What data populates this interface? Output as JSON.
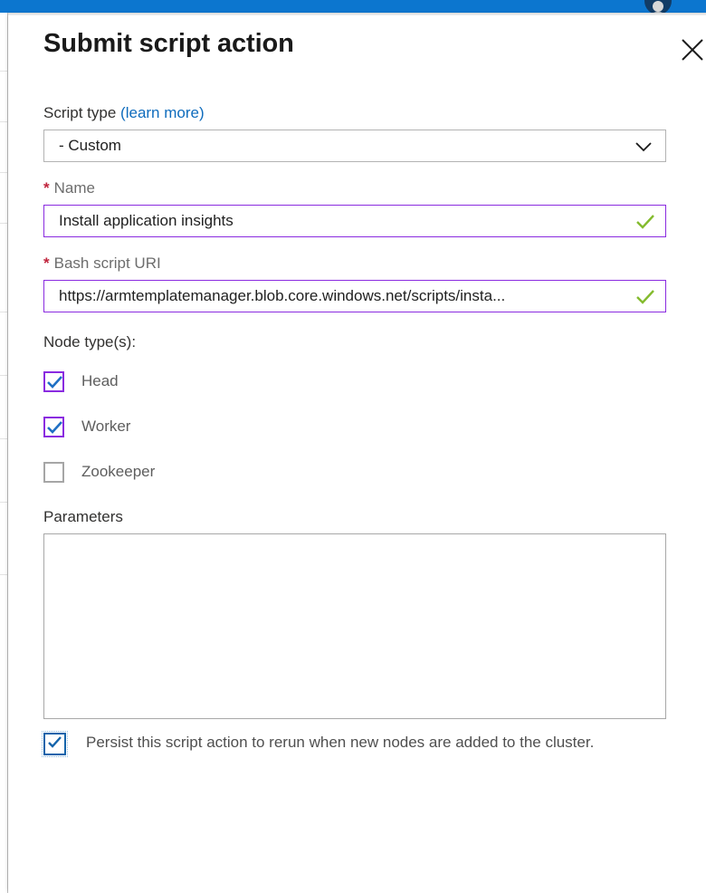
{
  "chrome": {
    "top_bar_color": "#0c76cf",
    "avatar_name": "user-avatar"
  },
  "blade": {
    "title": "Submit script action",
    "close_label": "Close"
  },
  "form": {
    "script_type": {
      "label": "Script type",
      "learn_more": "(learn more)",
      "selected": "- Custom",
      "chevron": "chevron-down-icon"
    },
    "name": {
      "required_marker": "*",
      "label": "Name",
      "value": "Install application insights",
      "placeholder": "",
      "validation": "valid"
    },
    "bash_script_uri": {
      "required_marker": "*",
      "label": "Bash script URI",
      "value": "https://armtemplatemanager.blob.core.windows.net/scripts/insta...",
      "placeholder": "",
      "validation": "valid"
    },
    "node_types": {
      "label": "Node type(s):",
      "options": [
        {
          "label": "Head",
          "checked": true
        },
        {
          "label": "Worker",
          "checked": true
        },
        {
          "label": "Zookeeper",
          "checked": false
        }
      ]
    },
    "parameters": {
      "label": "Parameters",
      "value": "",
      "placeholder": ""
    },
    "persist": {
      "checked": true,
      "label": "Persist this script action to rerun when new nodes are added to the cluster."
    }
  },
  "colors": {
    "accent_blue": "#0c76cf",
    "link_blue": "#0f6cbd",
    "field_border_purple": "#8a2be0",
    "valid_green": "#84bb2e",
    "required_red": "#c0253d",
    "check_blue": "#1464ab"
  }
}
